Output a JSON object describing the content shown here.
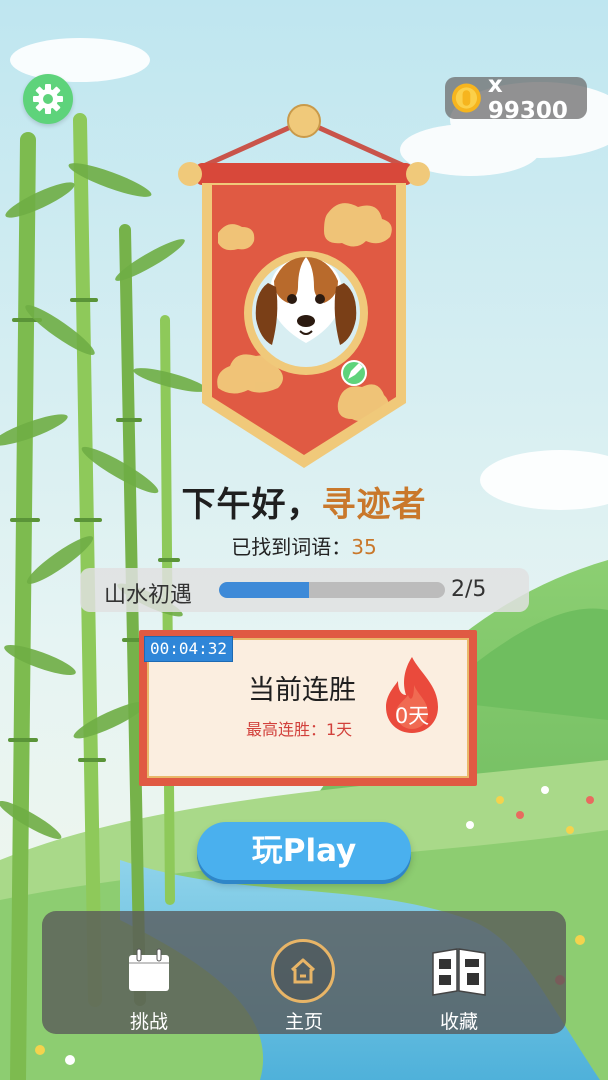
{
  "top_bar": {
    "settings_icon": "gear-icon",
    "coins_text": "x 99300",
    "coin_icon": "coin-icon"
  },
  "profile": {
    "avatar": "beagle-dog-avatar",
    "edit_icon": "edit-icon"
  },
  "greeting": {
    "prefix": "下午好，",
    "name": "寻迹者"
  },
  "words_found": {
    "label": "已找到词语：",
    "count": "35"
  },
  "level": {
    "name": "山水初遇",
    "count": "2/5",
    "progress": 0.4
  },
  "streak": {
    "timer": "00:04:32",
    "title": "当前连胜",
    "best": "最高连胜：1天",
    "days": "0天",
    "icon": "flame-icon"
  },
  "play_button": {
    "label": "玩Play"
  },
  "nav": {
    "items": [
      {
        "label": "挑战",
        "icon": "calendar-icon"
      },
      {
        "label": "主页",
        "icon": "home-icon"
      },
      {
        "label": "收藏",
        "icon": "book-icon"
      }
    ]
  },
  "colors": {
    "accent_orange": "#c9782b",
    "play_blue": "#4ab0ee",
    "settings_green": "#5ed37b",
    "banner_red": "#e05a43"
  }
}
